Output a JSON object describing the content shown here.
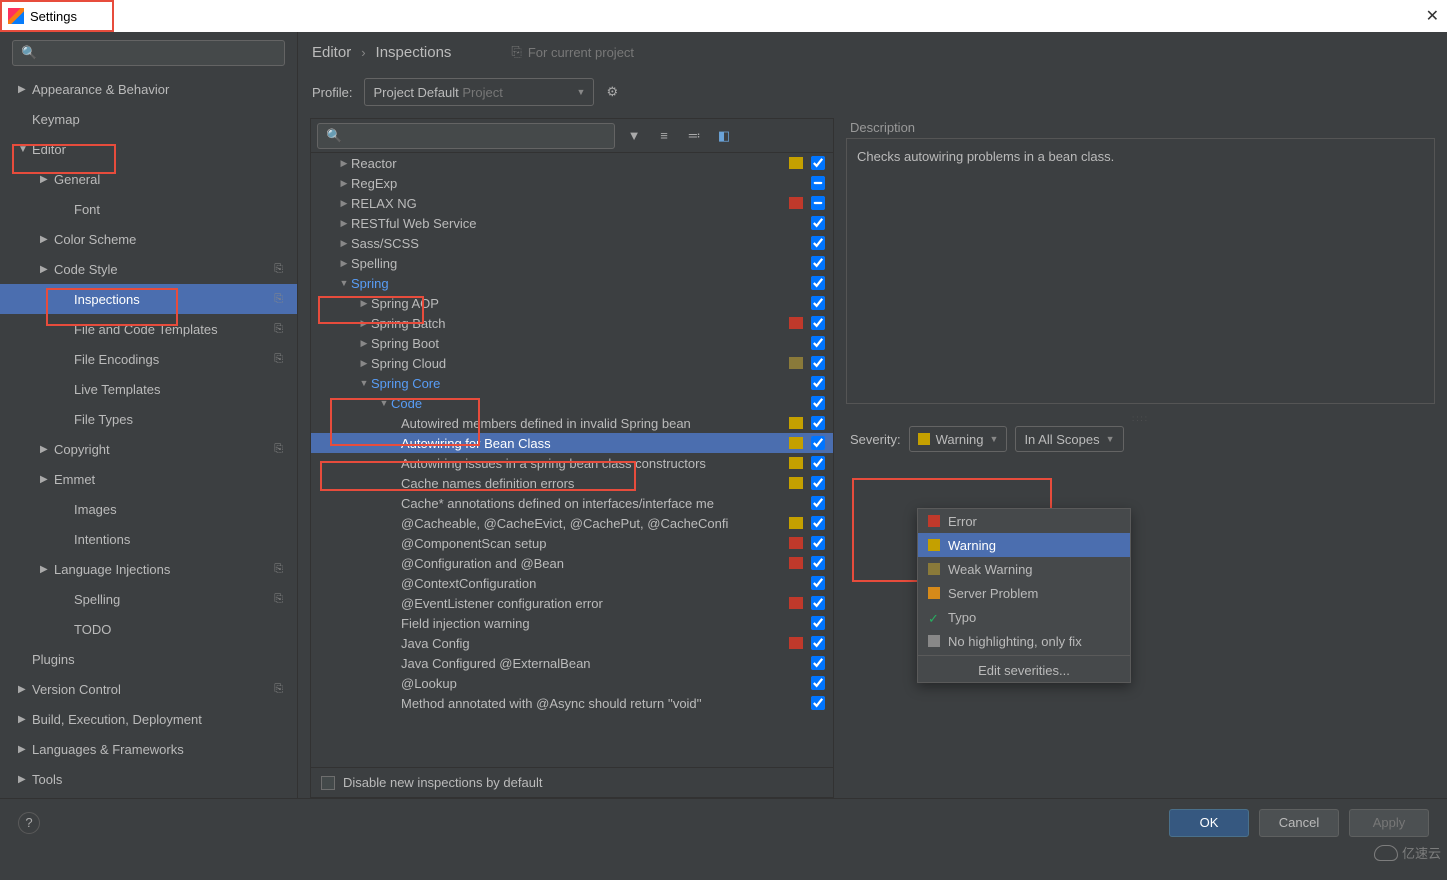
{
  "window": {
    "title": "Settings"
  },
  "breadcrumb": {
    "a": "Editor",
    "b": "Inspections",
    "project": "For current project"
  },
  "profile": {
    "label": "Profile:",
    "name": "Project Default",
    "suffix": "Project"
  },
  "sidebar": {
    "items": [
      {
        "label": "Appearance & Behavior",
        "depth": 0,
        "arrow": "closed"
      },
      {
        "label": "Keymap",
        "depth": 0,
        "arrow": "none"
      },
      {
        "label": "Editor",
        "depth": 0,
        "arrow": "open"
      },
      {
        "label": "General",
        "depth": 1,
        "arrow": "closed"
      },
      {
        "label": "Font",
        "depth": 2,
        "arrow": "none"
      },
      {
        "label": "Color Scheme",
        "depth": 1,
        "arrow": "closed"
      },
      {
        "label": "Code Style",
        "depth": 1,
        "arrow": "closed",
        "tag": true
      },
      {
        "label": "Inspections",
        "depth": 2,
        "arrow": "none",
        "tag": true,
        "selected": true
      },
      {
        "label": "File and Code Templates",
        "depth": 2,
        "arrow": "none",
        "tag": true
      },
      {
        "label": "File Encodings",
        "depth": 2,
        "arrow": "none",
        "tag": true
      },
      {
        "label": "Live Templates",
        "depth": 2,
        "arrow": "none"
      },
      {
        "label": "File Types",
        "depth": 2,
        "arrow": "none"
      },
      {
        "label": "Copyright",
        "depth": 1,
        "arrow": "closed",
        "tag": true
      },
      {
        "label": "Emmet",
        "depth": 1,
        "arrow": "closed"
      },
      {
        "label": "Images",
        "depth": 2,
        "arrow": "none"
      },
      {
        "label": "Intentions",
        "depth": 2,
        "arrow": "none"
      },
      {
        "label": "Language Injections",
        "depth": 1,
        "arrow": "closed",
        "tag": true
      },
      {
        "label": "Spelling",
        "depth": 2,
        "arrow": "none",
        "tag": true
      },
      {
        "label": "TODO",
        "depth": 2,
        "arrow": "none"
      },
      {
        "label": "Plugins",
        "depth": 0,
        "arrow": "none"
      },
      {
        "label": "Version Control",
        "depth": 0,
        "arrow": "closed",
        "tag": true
      },
      {
        "label": "Build, Execution, Deployment",
        "depth": 0,
        "arrow": "closed"
      },
      {
        "label": "Languages & Frameworks",
        "depth": 0,
        "arrow": "closed"
      },
      {
        "label": "Tools",
        "depth": 0,
        "arrow": "closed"
      }
    ]
  },
  "tree": {
    "items": [
      {
        "label": "Reactor",
        "indent": 26,
        "arrow": "closed",
        "color": "#c4a000",
        "check": "on"
      },
      {
        "label": "RegExp",
        "indent": 26,
        "arrow": "closed",
        "color": "",
        "check": "mixed"
      },
      {
        "label": "RELAX NG",
        "indent": 26,
        "arrow": "closed",
        "color": "#c0392b",
        "check": "mixed"
      },
      {
        "label": "RESTful Web Service",
        "indent": 26,
        "arrow": "closed",
        "color": "",
        "check": "on"
      },
      {
        "label": "Sass/SCSS",
        "indent": 26,
        "arrow": "closed",
        "color": "",
        "check": "on"
      },
      {
        "label": "Spelling",
        "indent": 26,
        "arrow": "closed",
        "color": "",
        "check": "on"
      },
      {
        "label": "Spring",
        "indent": 26,
        "arrow": "open",
        "link": true,
        "color": "",
        "check": "on"
      },
      {
        "label": "Spring AOP",
        "indent": 46,
        "arrow": "closed",
        "color": "",
        "check": "on"
      },
      {
        "label": "Spring Batch",
        "indent": 46,
        "arrow": "closed",
        "color": "#c0392b",
        "check": "on"
      },
      {
        "label": "Spring Boot",
        "indent": 46,
        "arrow": "closed",
        "color": "",
        "check": "on"
      },
      {
        "label": "Spring Cloud",
        "indent": 46,
        "arrow": "closed",
        "color": "#8a7a3a",
        "check": "on"
      },
      {
        "label": "Spring Core",
        "indent": 46,
        "arrow": "open",
        "link": true,
        "color": "",
        "check": "on"
      },
      {
        "label": "Code",
        "indent": 66,
        "arrow": "open",
        "link": true,
        "color": "",
        "check": "on"
      },
      {
        "label": "Autowired members defined in invalid Spring bean",
        "indent": 90,
        "arrow": "",
        "color": "#c4a000",
        "check": "on"
      },
      {
        "label": "Autowiring for Bean Class",
        "indent": 90,
        "arrow": "",
        "color": "#c4a000",
        "check": "on",
        "selected": true
      },
      {
        "label": "Autowiring issues in a spring bean class constructors",
        "indent": 90,
        "arrow": "",
        "color": "#c4a000",
        "check": "on"
      },
      {
        "label": "Cache names definition errors",
        "indent": 90,
        "arrow": "",
        "color": "#c4a000",
        "check": "on"
      },
      {
        "label": "Cache* annotations defined on interfaces/interface me",
        "indent": 90,
        "arrow": "",
        "color": "",
        "check": "on"
      },
      {
        "label": "@Cacheable, @CacheEvict, @CachePut, @CacheConfi",
        "indent": 90,
        "arrow": "",
        "color": "#c4a000",
        "check": "on"
      },
      {
        "label": "@ComponentScan setup",
        "indent": 90,
        "arrow": "",
        "color": "#c0392b",
        "check": "on"
      },
      {
        "label": "@Configuration and @Bean",
        "indent": 90,
        "arrow": "",
        "color": "#c0392b",
        "check": "on"
      },
      {
        "label": "@ContextConfiguration",
        "indent": 90,
        "arrow": "",
        "color": "",
        "check": "on"
      },
      {
        "label": "@EventListener configuration error",
        "indent": 90,
        "arrow": "",
        "color": "#c0392b",
        "check": "on"
      },
      {
        "label": "Field injection warning",
        "indent": 90,
        "arrow": "",
        "color": "",
        "check": "on"
      },
      {
        "label": "Java Config",
        "indent": 90,
        "arrow": "",
        "color": "#c0392b",
        "check": "on"
      },
      {
        "label": "Java Configured @ExternalBean",
        "indent": 90,
        "arrow": "",
        "color": "",
        "check": "on"
      },
      {
        "label": "@Lookup",
        "indent": 90,
        "arrow": "",
        "color": "",
        "check": "on"
      },
      {
        "label": "Method annotated with @Async should return ''void''",
        "indent": 90,
        "arrow": "",
        "color": "",
        "check": "on"
      }
    ],
    "disable_new": "Disable new inspections by default"
  },
  "description": {
    "head": "Description",
    "body": "Checks autowiring problems in a bean class."
  },
  "severity": {
    "label": "Severity:",
    "current": "Warning",
    "current_color": "#c4a000",
    "scope": "In All Scopes",
    "options": [
      {
        "label": "Error",
        "color": "#c0392b"
      },
      {
        "label": "Warning",
        "color": "#c4a000",
        "selected": true
      },
      {
        "label": "Weak Warning",
        "color": "#8a7a3a"
      },
      {
        "label": "Server Problem",
        "color": "#d68a1a"
      },
      {
        "label": "Typo",
        "color": "#27ae60",
        "typo": true
      },
      {
        "label": "No highlighting, only fix",
        "color": "#888888"
      }
    ],
    "edit": "Edit severities..."
  },
  "footer": {
    "ok": "OK",
    "cancel": "Cancel",
    "apply": "Apply"
  },
  "watermark": "亿速云"
}
